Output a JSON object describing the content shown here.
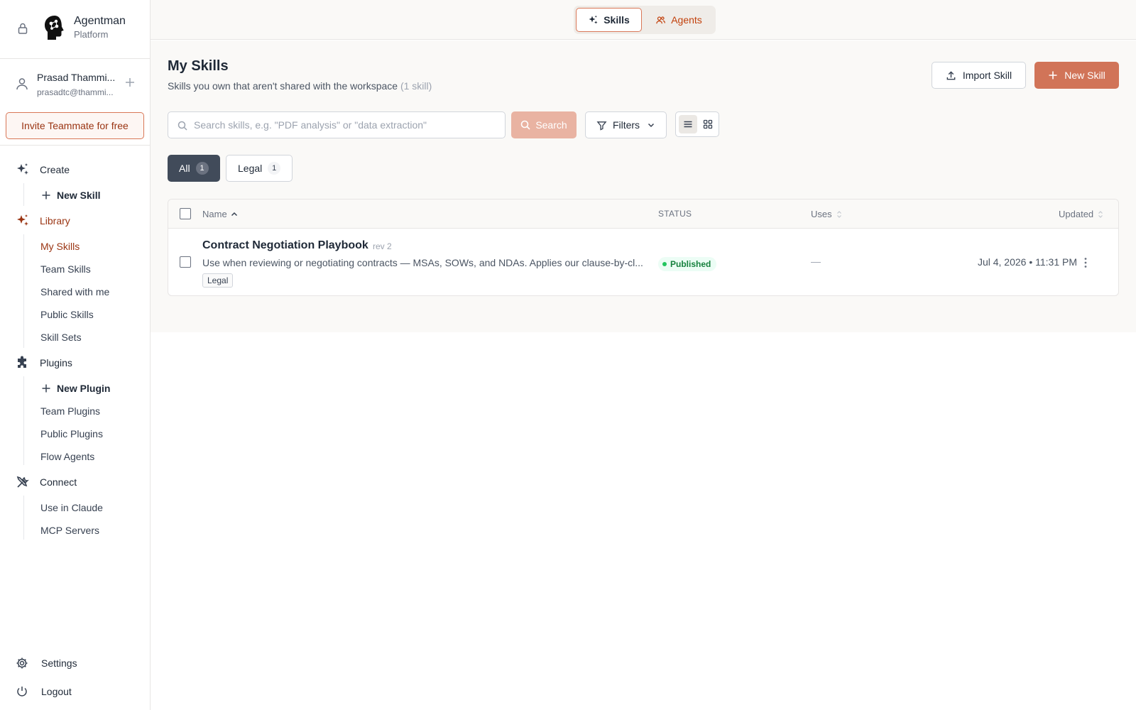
{
  "brand": {
    "name": "Agentman",
    "sub": "Platform"
  },
  "user": {
    "name": "Prasad Thammi...",
    "email": "prasadtc@thammi..."
  },
  "invite_label": "Invite Teammate for free",
  "nav": {
    "create": {
      "label": "Create",
      "new_skill": "New Skill"
    },
    "library": {
      "label": "Library",
      "items": [
        "My Skills",
        "Team Skills",
        "Shared with me",
        "Public Skills",
        "Skill Sets"
      ]
    },
    "plugins": {
      "label": "Plugins",
      "new_plugin": "New Plugin",
      "items": [
        "Team Plugins",
        "Public Plugins",
        "Flow Agents"
      ]
    },
    "connect": {
      "label": "Connect",
      "items": [
        "Use in Claude",
        "MCP Servers"
      ]
    },
    "settings": "Settings",
    "logout": "Logout"
  },
  "topbar": {
    "skills": "Skills",
    "agents": "Agents"
  },
  "page": {
    "title": "My Skills",
    "subtitle": "Skills you own that aren't shared with the workspace",
    "count": "(1 skill)",
    "import_label": "Import Skill",
    "new_label": "New Skill"
  },
  "search": {
    "placeholder": "Search skills, e.g. \"PDF analysis\" or \"data extraction\"",
    "button": "Search"
  },
  "filters_label": "Filters",
  "chips": [
    {
      "label": "All",
      "count": "1"
    },
    {
      "label": "Legal",
      "count": "1"
    }
  ],
  "table": {
    "headers": {
      "name": "Name",
      "status": "STATUS",
      "uses": "Uses",
      "updated": "Updated"
    },
    "rows": [
      {
        "title": "Contract Negotiation Playbook",
        "rev": "rev 2",
        "description": "Use when reviewing or negotiating contracts — MSAs, SOWs, and NDAs. Applies our clause-by-cl...",
        "tag": "Legal",
        "status": "Published",
        "uses": "—",
        "updated": "Jul 4, 2026 • 11:31 PM"
      }
    ]
  },
  "colors": {
    "accent": "#d17458",
    "active_nav": "#9a3412",
    "chip_active": "#414b5a",
    "published": "#15803d"
  }
}
